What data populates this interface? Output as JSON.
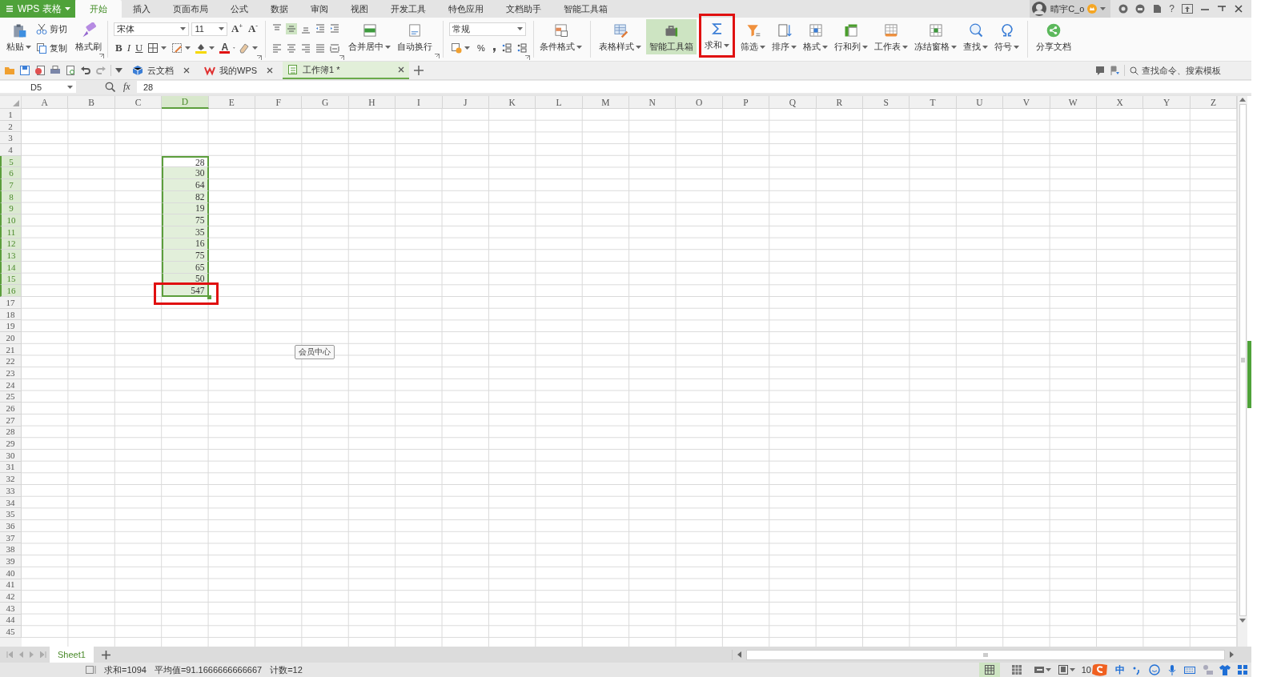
{
  "title_bar": {
    "app_menu": "WPS 表格",
    "tabs": [
      {
        "label": "开始",
        "selected": true
      },
      {
        "label": "插入",
        "selected": false
      },
      {
        "label": "页面布局",
        "selected": false
      },
      {
        "label": "公式",
        "selected": false
      },
      {
        "label": "数据",
        "selected": false
      },
      {
        "label": "审阅",
        "selected": false
      },
      {
        "label": "视图",
        "selected": false
      },
      {
        "label": "开发工具",
        "selected": false
      },
      {
        "label": "特色应用",
        "selected": false
      },
      {
        "label": "文档助手",
        "selected": false
      },
      {
        "label": "智能工具箱",
        "selected": false
      }
    ],
    "user": {
      "name": "晴宇C_o"
    },
    "help": "?"
  },
  "ribbon": {
    "clipboard": {
      "paste": "粘贴",
      "cut": "剪切",
      "copy": "复制",
      "format_painter": "格式刷"
    },
    "font": {
      "name": "宋体",
      "size": "11",
      "size_buttons": [
        "A$^{+}$",
        "A$^{-}$"
      ],
      "style_buttons": [
        "B",
        "I",
        "U"
      ],
      "font_color": "A"
    },
    "alignment": {
      "merge_center": "合并居中",
      "wrap_text": "自动换行"
    },
    "number": {
      "format": "常规",
      "percent": "%"
    },
    "tools": [
      {
        "label": "条件格式",
        "dropdown": true,
        "selected": false,
        "highlighted": false
      },
      {
        "label": "表格样式",
        "dropdown": true,
        "selected": false,
        "highlighted": false
      },
      {
        "label": "智能工具箱",
        "dropdown": false,
        "selected": true,
        "highlighted": false
      },
      {
        "label": "求和",
        "dropdown": true,
        "selected": false,
        "highlighted": true
      },
      {
        "label": "筛选",
        "dropdown": true,
        "selected": false,
        "highlighted": false
      },
      {
        "label": "排序",
        "dropdown": true,
        "selected": false,
        "highlighted": false
      },
      {
        "label": "格式",
        "dropdown": true,
        "selected": false,
        "highlighted": false
      },
      {
        "label": "行和列",
        "dropdown": true,
        "selected": false,
        "highlighted": false
      },
      {
        "label": "工作表",
        "dropdown": true,
        "selected": false,
        "highlighted": false
      },
      {
        "label": "冻结窗格",
        "dropdown": true,
        "selected": false,
        "highlighted": false
      },
      {
        "label": "查找",
        "dropdown": true,
        "selected": false,
        "highlighted": false
      },
      {
        "label": "符号",
        "dropdown": true,
        "selected": false,
        "highlighted": false
      },
      {
        "label": "分享文档",
        "dropdown": false,
        "selected": false,
        "highlighted": false
      }
    ]
  },
  "doc_bar": {
    "tabs": [
      {
        "label": "云文档",
        "selected": false
      },
      {
        "label": "我的WPS",
        "selected": false
      },
      {
        "label": "工作簿1 *",
        "selected": true
      }
    ],
    "search": {
      "placeholder": "查找命令、搜索模板"
    }
  },
  "formula_bar": {
    "name_box": "D5",
    "fx": "fx",
    "value": "28"
  },
  "grid": {
    "columns": [
      {
        "label": "A",
        "selected": false
      },
      {
        "label": "B",
        "selected": false
      },
      {
        "label": "C",
        "selected": false
      },
      {
        "label": "D",
        "selected": true
      },
      {
        "label": "E",
        "selected": false
      },
      {
        "label": "F",
        "selected": false
      },
      {
        "label": "G",
        "selected": false
      },
      {
        "label": "H",
        "selected": false
      },
      {
        "label": "I",
        "selected": false
      },
      {
        "label": "J",
        "selected": false
      },
      {
        "label": "K",
        "selected": false
      },
      {
        "label": "L",
        "selected": false
      },
      {
        "label": "M",
        "selected": false
      },
      {
        "label": "N",
        "selected": false
      },
      {
        "label": "O",
        "selected": false
      },
      {
        "label": "P",
        "selected": false
      },
      {
        "label": "Q",
        "selected": false
      },
      {
        "label": "R",
        "selected": false
      },
      {
        "label": "S",
        "selected": false
      },
      {
        "label": "T",
        "selected": false
      },
      {
        "label": "U",
        "selected": false
      },
      {
        "label": "V",
        "selected": false
      },
      {
        "label": "W",
        "selected": false
      },
      {
        "label": "X",
        "selected": false
      },
      {
        "label": "Y",
        "selected": false
      },
      {
        "label": "Z",
        "selected": false
      }
    ],
    "rows": [
      {
        "label": "1",
        "selected": false
      },
      {
        "label": "2",
        "selected": false
      },
      {
        "label": "3",
        "selected": false
      },
      {
        "label": "4",
        "selected": false
      },
      {
        "label": "5",
        "selected": true
      },
      {
        "label": "6",
        "selected": true
      },
      {
        "label": "7",
        "selected": true
      },
      {
        "label": "8",
        "selected": true
      },
      {
        "label": "9",
        "selected": true
      },
      {
        "label": "10",
        "selected": true
      },
      {
        "label": "11",
        "selected": true
      },
      {
        "label": "12",
        "selected": true
      },
      {
        "label": "13",
        "selected": true
      },
      {
        "label": "14",
        "selected": true
      },
      {
        "label": "15",
        "selected": true
      },
      {
        "label": "16",
        "selected": true
      },
      {
        "label": "17",
        "selected": false
      },
      {
        "label": "18",
        "selected": false
      },
      {
        "label": "19",
        "selected": false
      },
      {
        "label": "20",
        "selected": false
      },
      {
        "label": "21",
        "selected": false
      },
      {
        "label": "22",
        "selected": false
      },
      {
        "label": "23",
        "selected": false
      },
      {
        "label": "24",
        "selected": false
      },
      {
        "label": "25",
        "selected": false
      },
      {
        "label": "26",
        "selected": false
      },
      {
        "label": "27",
        "selected": false
      },
      {
        "label": "28",
        "selected": false
      },
      {
        "label": "29",
        "selected": false
      },
      {
        "label": "30",
        "selected": false
      },
      {
        "label": "31",
        "selected": false
      },
      {
        "label": "32",
        "selected": false
      },
      {
        "label": "33",
        "selected": false
      },
      {
        "label": "34",
        "selected": false
      },
      {
        "label": "35",
        "selected": false
      },
      {
        "label": "36",
        "selected": false
      },
      {
        "label": "37",
        "selected": false
      },
      {
        "label": "38",
        "selected": false
      },
      {
        "label": "39",
        "selected": false
      },
      {
        "label": "40",
        "selected": false
      },
      {
        "label": "41",
        "selected": false
      },
      {
        "label": "42",
        "selected": false
      },
      {
        "label": "43",
        "selected": false
      },
      {
        "label": "44",
        "selected": false
      },
      {
        "label": "45",
        "selected": false
      }
    ],
    "cells": [
      {
        "value": "28",
        "active": true,
        "highlighted": false
      },
      {
        "value": "30",
        "active": false,
        "highlighted": false
      },
      {
        "value": "64",
        "active": false,
        "highlighted": false
      },
      {
        "value": "82",
        "active": false,
        "highlighted": false
      },
      {
        "value": "19",
        "active": false,
        "highlighted": false
      },
      {
        "value": "75",
        "active": false,
        "highlighted": false
      },
      {
        "value": "35",
        "active": false,
        "highlighted": false
      },
      {
        "value": "16",
        "active": false,
        "highlighted": false
      },
      {
        "value": "75",
        "active": false,
        "highlighted": false
      },
      {
        "value": "65",
        "active": false,
        "highlighted": false
      },
      {
        "value": "50",
        "active": false,
        "highlighted": false
      },
      {
        "value": "547",
        "active": false,
        "highlighted": true
      }
    ]
  },
  "tooltip": "会员中心",
  "sheet_tabs": [
    {
      "label": "Sheet1",
      "selected": true
    }
  ],
  "status_bar": {
    "stats": [
      "求和=1094",
      "平均值=91.1666666666667",
      "计数=12"
    ],
    "views": [
      {
        "selected": true
      },
      {
        "selected": false
      }
    ],
    "zoom": "10",
    "ime": "中"
  }
}
